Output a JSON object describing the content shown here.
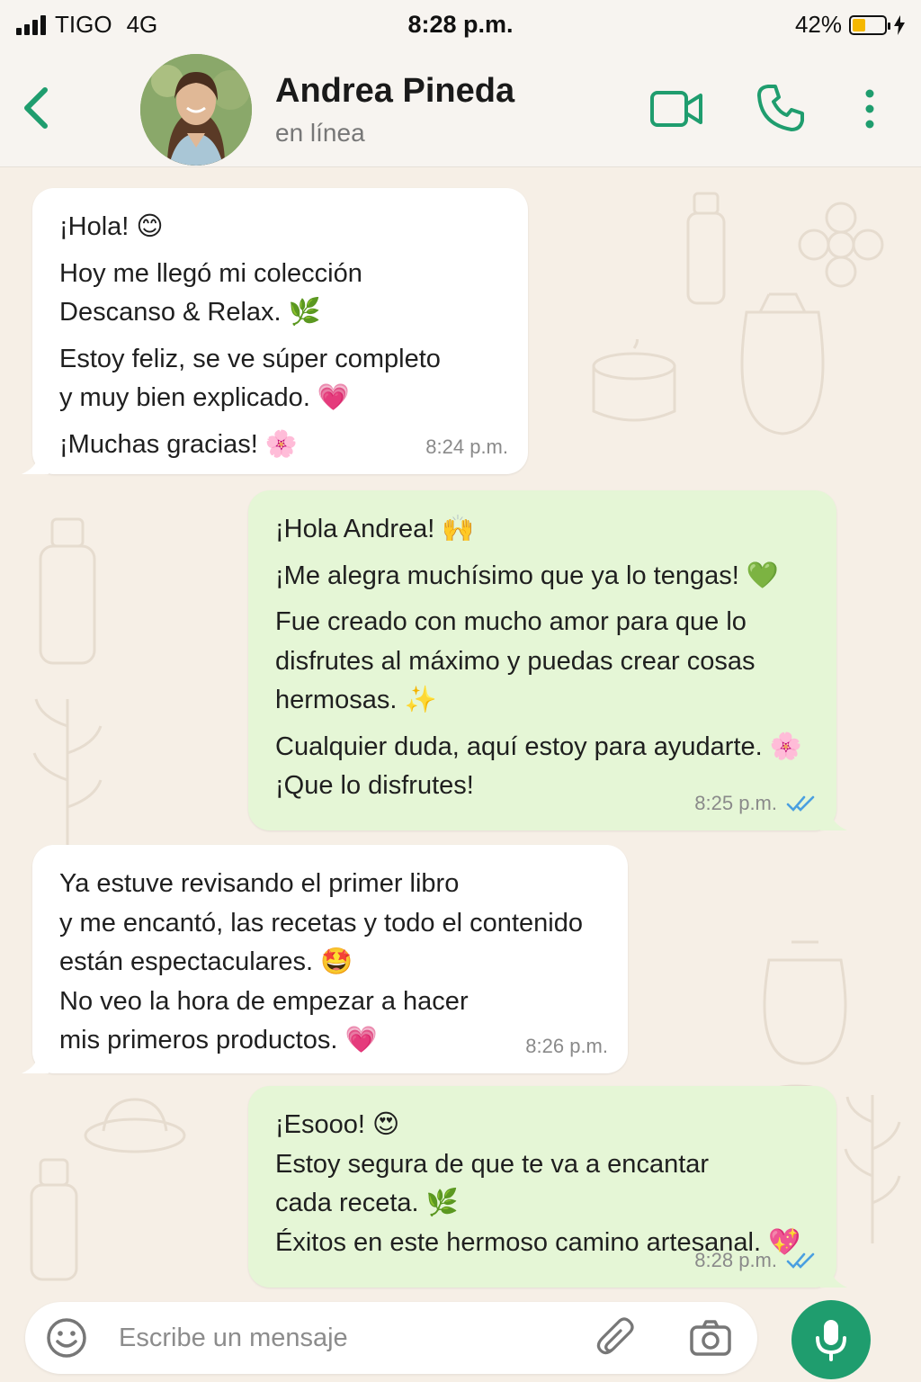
{
  "status_bar": {
    "carrier": "TIGO",
    "network": "4G",
    "time": "8:28 p.m.",
    "battery_percent": "42%",
    "battery_level": 0.42
  },
  "header": {
    "contact_name": "Andrea Pineda",
    "contact_status": "en línea",
    "icons": [
      "back-arrow-icon",
      "video-call-icon",
      "phone-icon",
      "more-options-icon"
    ],
    "accent_color": "#1f9d6e"
  },
  "messages": [
    {
      "direction": "incoming",
      "lines": [
        "¡Hola! 😊",
        "Hoy me llegó mi colección",
        "Descanso & Relax. 🌿",
        "Estoy feliz, se ve súper completo",
        "y muy bien explicado. 💗",
        "¡Muchas gracias! 🌸"
      ],
      "time": "8:24 p.m."
    },
    {
      "direction": "outgoing",
      "lines": [
        "¡Hola Andrea! 🙌",
        "¡Me alegra muchísimo que ya lo tengas! 💚",
        "Fue creado con mucho amor para que lo",
        "disfrutes al máximo y puedas crear cosas",
        "hermosas. ✨",
        "Cualquier duda, aquí estoy para ayudarte. 🌸",
        "¡Que lo disfrutes!"
      ],
      "time": "8:25 p.m.",
      "read": true
    },
    {
      "direction": "incoming",
      "lines": [
        "Ya estuve revisando el primer libro",
        "y me encantó, las recetas y todo el contenido",
        "están espectaculares. 🤩",
        "No veo la hora de empezar a hacer",
        "mis primeros productos. 💗"
      ],
      "time": "8:26 p.m."
    },
    {
      "direction": "outgoing",
      "lines": [
        "¡Esooo! 😍",
        "Estoy segura de que te va a encantar",
        "cada receta. 🌿",
        "Éxitos en este hermoso camino artesanal. 💖"
      ],
      "time": "8:28 p.m.",
      "read": true
    }
  ],
  "composer": {
    "placeholder": "Escribe un mensaje",
    "icons": [
      "emoji-icon",
      "attach-icon",
      "camera-icon",
      "microphone-icon"
    ]
  },
  "colors": {
    "incoming_bubble": "#ffffff",
    "outgoing_bubble": "#e5f6d6",
    "read_ticks": "#4a9fe0",
    "chat_background": "#f6efe6"
  }
}
